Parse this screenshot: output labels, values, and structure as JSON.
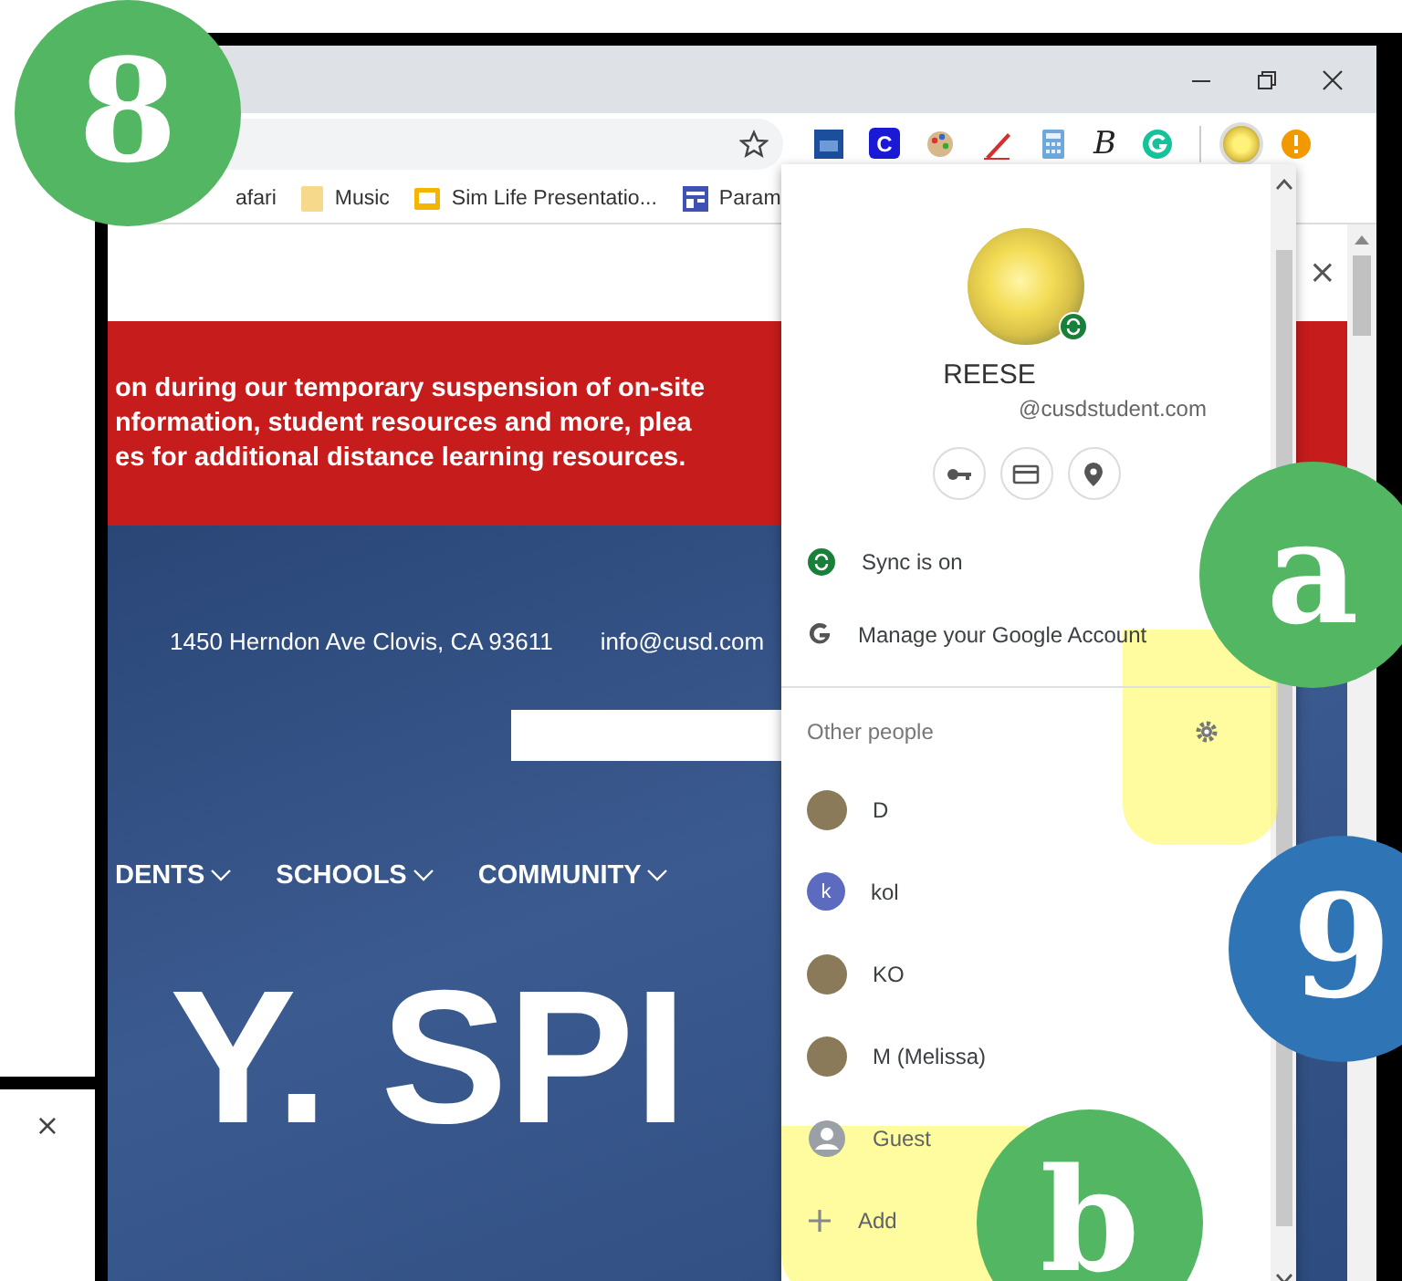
{
  "side_window": {
    "close": "×"
  },
  "browser": {
    "extensions": [
      {
        "kind": "calendar"
      },
      {
        "kind": "letter",
        "glyph": "C"
      },
      {
        "kind": "palette"
      },
      {
        "kind": "pen"
      },
      {
        "kind": "calculator"
      },
      {
        "kind": "script",
        "glyph": "B"
      },
      {
        "kind": "grammar"
      }
    ],
    "bookmarks": [
      {
        "kind": "plain",
        "label": "afari"
      },
      {
        "kind": "folder",
        "label": "Music"
      },
      {
        "kind": "slides",
        "label": "Sim Life Presentatio..."
      },
      {
        "kind": "form",
        "label": "Param"
      }
    ]
  },
  "page": {
    "close": "×",
    "banner": [
      "on during our temporary suspension of on-site",
      "nformation, student resources and more, plea",
      "es for additional distance learning resources."
    ],
    "address": "1450 Herndon Ave Clovis, CA 93611",
    "email": "info@cusd.com",
    "nav": [
      {
        "label": "DENTS"
      },
      {
        "label": "SCHOOLS"
      },
      {
        "label": "COMMUNITY"
      }
    ],
    "hero_text": "Y. SPI"
  },
  "profile_menu": {
    "name": "REESE",
    "email": "@cusdstudent.com",
    "sync": "Sync is on",
    "manage": "Manage your Google Account",
    "other_people": "Other people",
    "people": [
      {
        "kind": "photo",
        "name": "D"
      },
      {
        "kind": "letter",
        "initial": "k",
        "name": "kol"
      },
      {
        "kind": "photo",
        "name": "KO"
      },
      {
        "kind": "photo",
        "name": "M (Melissa)"
      },
      {
        "kind": "guest",
        "name": "Guest"
      }
    ],
    "add": "Add"
  },
  "annotations": [
    {
      "label": "8",
      "color": "#52b663"
    },
    {
      "label": "a",
      "color": "#52b663"
    },
    {
      "label": "9",
      "color": "#2f74b5"
    },
    {
      "label": "b",
      "color": "#52b663"
    }
  ]
}
